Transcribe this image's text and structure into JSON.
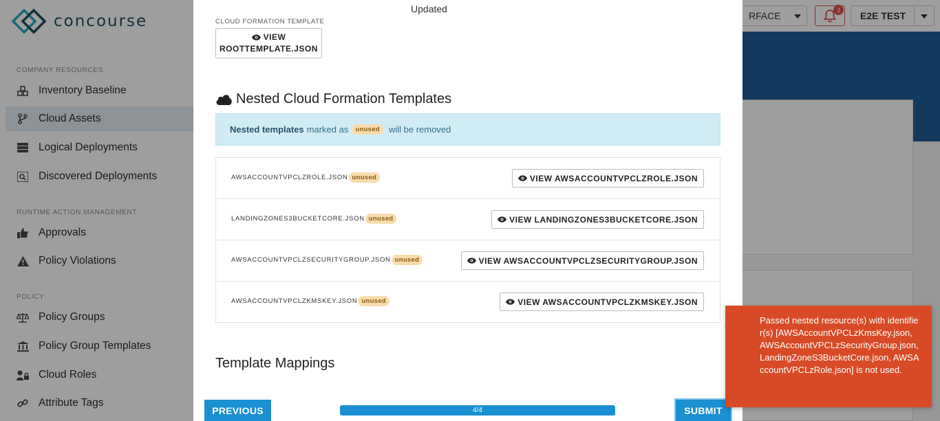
{
  "app": {
    "logo_text": "concourse"
  },
  "sidebar": {
    "sections": [
      {
        "label": "COMPANY RESOURCES"
      },
      {
        "label": "RUNTIME ACTION MANAGEMENT"
      },
      {
        "label": "POLICY"
      }
    ],
    "items": [
      {
        "label": "Inventory Baseline",
        "icon": "cubes-icon"
      },
      {
        "label": "Cloud Assets",
        "icon": "branch-icon",
        "active": true
      },
      {
        "label": "Logical Deployments",
        "icon": "server-icon"
      },
      {
        "label": "Discovered Deployments",
        "icon": "search-server-icon"
      },
      {
        "label": "Approvals",
        "icon": "thumbs-up-icon"
      },
      {
        "label": "Policy Violations",
        "icon": "warning-icon"
      },
      {
        "label": "Policy Groups",
        "icon": "scale-icon"
      },
      {
        "label": "Policy Group Templates",
        "icon": "bank-icon"
      },
      {
        "label": "Cloud Roles",
        "icon": "user-lock-icon"
      },
      {
        "label": "Attribute Tags",
        "icon": "link-icon"
      }
    ]
  },
  "topbar": {
    "surface_select": "RFACE",
    "notifications_count": "3",
    "user_label": "E2E TEST"
  },
  "modal": {
    "status_text": "Updated",
    "cft_label": "CLOUD FORMATION TEMPLATE",
    "view_root_line1": "VIEW",
    "view_root_line2": "ROOTTEMPLATE.JSON",
    "nested_title": "Nested Cloud Formation Templates",
    "info": {
      "bold": "Nested templates",
      "middle": "marked as",
      "badge": "unused",
      "end": "will be removed"
    },
    "templates": [
      {
        "name": "AWSACCOUNTVPCLZROLE.JSON",
        "badge": "unused",
        "button": "VIEW AWSACCOUNTVPCLZROLE.JSON"
      },
      {
        "name": "LANDINGZONES3BUCKETCORE.JSON",
        "badge": "unused",
        "button": "VIEW LANDINGZONES3BUCKETCORE.JSON"
      },
      {
        "name": "AWSACCOUNTVPCLZSECURITYGROUP.JSON",
        "badge": "unused",
        "button": "VIEW AWSACCOUNTVPCLZSECURITYGROUP.JSON"
      },
      {
        "name": "AWSACCOUNTVPCLZKMSKEY.JSON",
        "badge": "unused",
        "button": "VIEW AWSACCOUNTVPCLZKMSKEY.JSON"
      }
    ],
    "mappings_title": "Template Mappings"
  },
  "wizard": {
    "previous_label": "PREVIOUS",
    "progress_text": "4/4",
    "progress_fraction": 1.0,
    "submit_label": "SUBMIT"
  },
  "toast": {
    "message": "Passed nested resource(s) with identifier(s) [AWSAccountVPCLzKmsKey.json, AWSAccountVPCLzSecurityGroup.json, LandingZoneS3BucketCore.json, AWSAccountVPCLzRole.json] is not used."
  },
  "colors": {
    "primary": "#1a8fd1",
    "toast": "#d84a26",
    "badge_bg": "#f8dcae",
    "info_bg": "#d1ecf4",
    "header_band": "#1f5c99"
  }
}
